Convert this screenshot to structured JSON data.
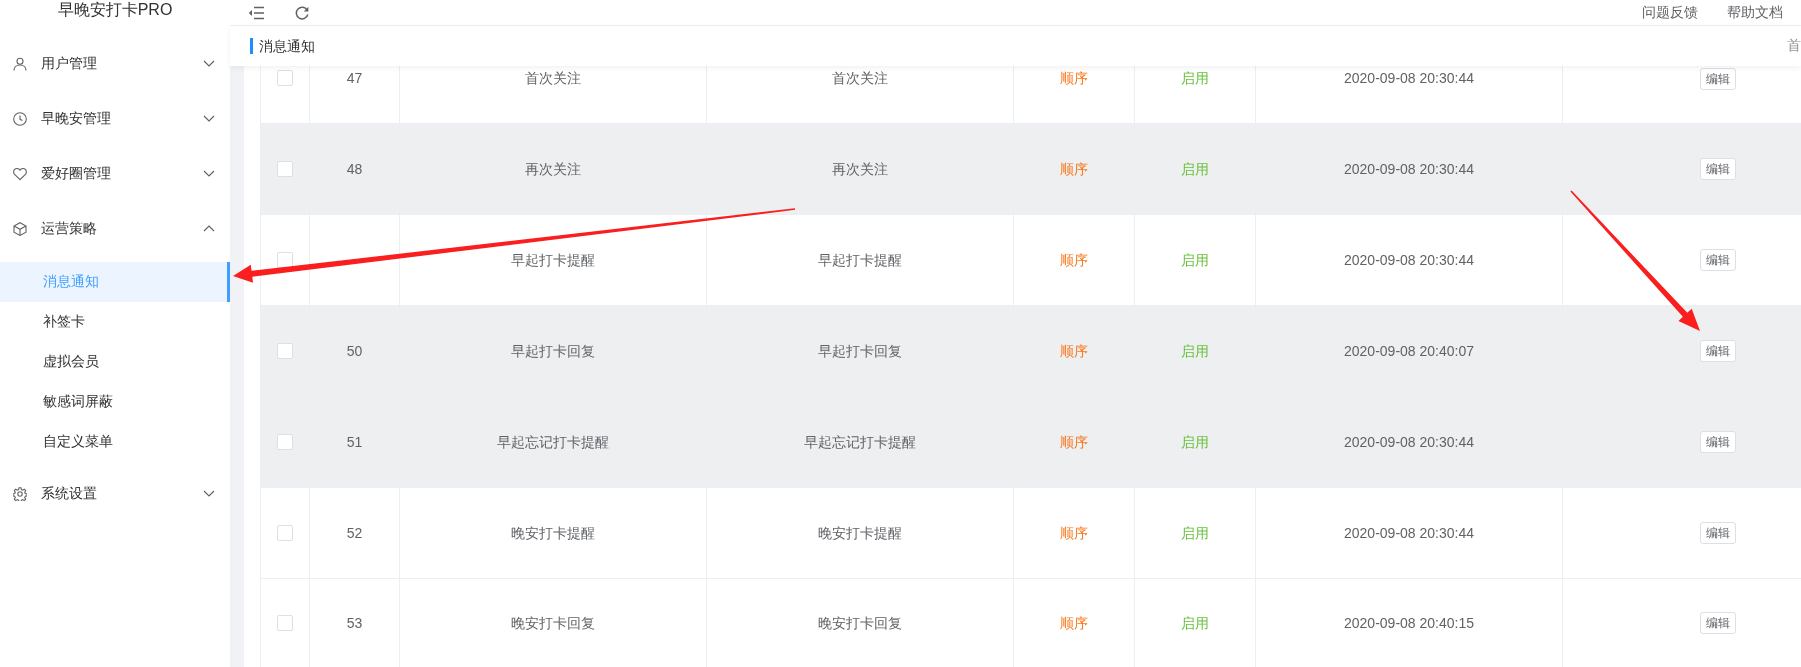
{
  "sidebar": {
    "title": "早晚安打卡PRO",
    "items": [
      {
        "label": "用户管理",
        "expanded": false
      },
      {
        "label": "早晚安管理",
        "expanded": false
      },
      {
        "label": "爱好圈管理",
        "expanded": false
      },
      {
        "label": "运营策略",
        "expanded": true,
        "children": [
          {
            "label": "消息通知",
            "selected": true
          },
          {
            "label": "补签卡",
            "selected": false
          },
          {
            "label": "虚拟会员",
            "selected": false
          },
          {
            "label": "敏感词屏蔽",
            "selected": false
          },
          {
            "label": "自定义菜单",
            "selected": false
          }
        ]
      },
      {
        "label": "系统设置",
        "expanded": false
      }
    ]
  },
  "header": {
    "links": [
      "问题反馈",
      "帮助文档"
    ]
  },
  "page_title": "消息通知",
  "breadcrumb": "首",
  "table": {
    "rows": [
      {
        "checked": false,
        "shaded": false,
        "column_2": "47",
        "column_3": "首次关注",
        "column_4": "首次关注",
        "column_5": "顺序",
        "column_6": "启用",
        "column_7": "2020-09-08 20:30:44",
        "action": "编辑"
      },
      {
        "checked": false,
        "shaded": true,
        "column_2": "48",
        "column_3": "再次关注",
        "column_4": "再次关注",
        "column_5": "顺序",
        "column_6": "启用",
        "column_7": "2020-09-08 20:30:44",
        "action": "编辑"
      },
      {
        "checked": false,
        "shaded": false,
        "column_3": "早起打卡提醒",
        "column_4": "早起打卡提醒",
        "column_5": "顺序",
        "column_6": "启用",
        "column_7": "2020-09-08 20:30:44",
        "action": "编辑"
      },
      {
        "checked": false,
        "shaded": true,
        "column_2": "50",
        "column_3": "早起打卡回复",
        "column_4": "早起打卡回复",
        "column_5": "顺序",
        "column_6": "启用",
        "column_7": "2020-09-08 20:40:07",
        "action": "编辑"
      },
      {
        "checked": false,
        "shaded": true,
        "column_2": "51",
        "column_3": "早起忘记打卡提醒",
        "column_4": "早起忘记打卡提醒",
        "column_5": "顺序",
        "column_6": "启用",
        "column_7": "2020-09-08 20:30:44",
        "action": "编辑"
      },
      {
        "checked": false,
        "shaded": false,
        "column_2": "52",
        "column_3": "晚安打卡提醒",
        "column_4": "晚安打卡提醒",
        "column_5": "顺序",
        "column_6": "启用",
        "column_7": "2020-09-08 20:30:44",
        "action": "编辑"
      },
      {
        "checked": false,
        "shaded": false,
        "column_2": "53",
        "column_3": "晚安打卡回复",
        "column_4": "晚安打卡回复",
        "column_5": "顺序",
        "column_6": "启用",
        "column_7": "2020-09-08 20:40:15",
        "action": "编辑"
      }
    ]
  }
}
